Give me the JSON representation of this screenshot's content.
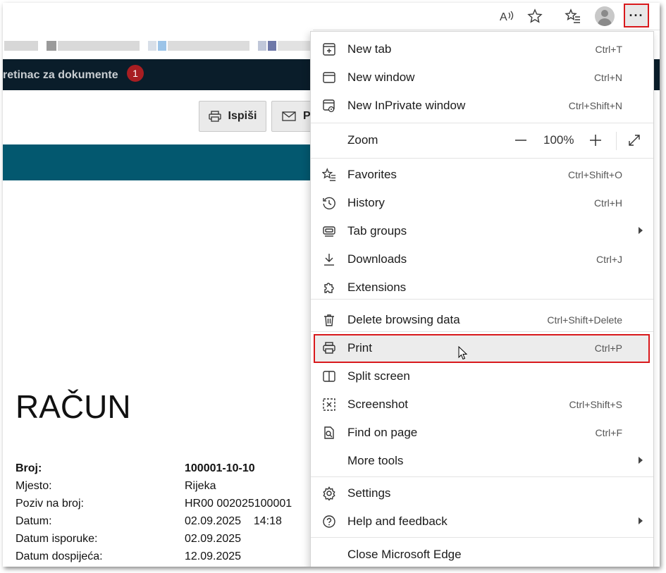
{
  "toolbar": {
    "icons": [
      "read-aloud-icon",
      "favorite-star-icon",
      "favorites-list-icon",
      "profile-avatar-icon",
      "more-options-icon"
    ],
    "more_label": "···"
  },
  "nav": {
    "title": "retinac za dokumente",
    "badge": "1"
  },
  "actions": {
    "print_label": "Ispiši",
    "mail_label": "P"
  },
  "document": {
    "title": "RAČUN",
    "rows": [
      {
        "key": "Broj:",
        "value": "100001-10-10",
        "bold": true
      },
      {
        "key": "Mjesto:",
        "value": "Rijeka"
      },
      {
        "key": "Poziv na broj:",
        "value": "HR00 002025100001"
      },
      {
        "key": "Datum:",
        "value": "02.09.2025    14:18"
      },
      {
        "key": "Datum isporuke:",
        "value": "02.09.2025"
      },
      {
        "key": "Datum dospijeća:",
        "value": "12.09.2025"
      }
    ]
  },
  "menu": {
    "items": [
      {
        "id": "new-tab",
        "label": "New tab",
        "shortcut": "Ctrl+T",
        "icon": "new-tab-icon"
      },
      {
        "id": "new-window",
        "label": "New window",
        "shortcut": "Ctrl+N",
        "icon": "window-icon"
      },
      {
        "id": "new-inprivate",
        "label": "New InPrivate window",
        "shortcut": "Ctrl+Shift+N",
        "icon": "inprivate-icon"
      },
      {
        "id": "favorites",
        "label": "Favorites",
        "shortcut": "Ctrl+Shift+O",
        "icon": "favorites-icon"
      },
      {
        "id": "history",
        "label": "History",
        "shortcut": "Ctrl+H",
        "icon": "history-icon"
      },
      {
        "id": "tab-groups",
        "label": "Tab groups",
        "shortcut": "",
        "icon": "tab-groups-icon"
      },
      {
        "id": "downloads",
        "label": "Downloads",
        "shortcut": "Ctrl+J",
        "icon": "download-icon"
      },
      {
        "id": "extensions",
        "label": "Extensions",
        "shortcut": "",
        "icon": "extensions-icon"
      },
      {
        "id": "delete-browsing-data",
        "label": "Delete browsing data",
        "shortcut": "Ctrl+Shift+Delete",
        "icon": "trash-icon"
      },
      {
        "id": "print",
        "label": "Print",
        "shortcut": "Ctrl+P",
        "icon": "printer-icon"
      },
      {
        "id": "split-screen",
        "label": "Split screen",
        "shortcut": "",
        "icon": "split-screen-icon"
      },
      {
        "id": "screenshot",
        "label": "Screenshot",
        "shortcut": "Ctrl+Shift+S",
        "icon": "screenshot-icon"
      },
      {
        "id": "find-on-page",
        "label": "Find on page",
        "shortcut": "Ctrl+F",
        "icon": "find-icon"
      },
      {
        "id": "more-tools",
        "label": "More tools",
        "shortcut": "",
        "icon": ""
      },
      {
        "id": "settings",
        "label": "Settings",
        "shortcut": "",
        "icon": "gear-icon"
      },
      {
        "id": "help-feedback",
        "label": "Help and feedback",
        "shortcut": "",
        "icon": "help-icon"
      },
      {
        "id": "close-edge",
        "label": "Close Microsoft Edge",
        "shortcut": "",
        "icon": ""
      }
    ],
    "zoom": {
      "label": "Zoom",
      "value": "100%",
      "minus": "—",
      "plus": "+"
    }
  },
  "colors": {
    "highlight_border": "#d9191c",
    "nav_bg": "#0a1d2a",
    "teal_bar": "#03586f",
    "badge": "#a81e22"
  }
}
